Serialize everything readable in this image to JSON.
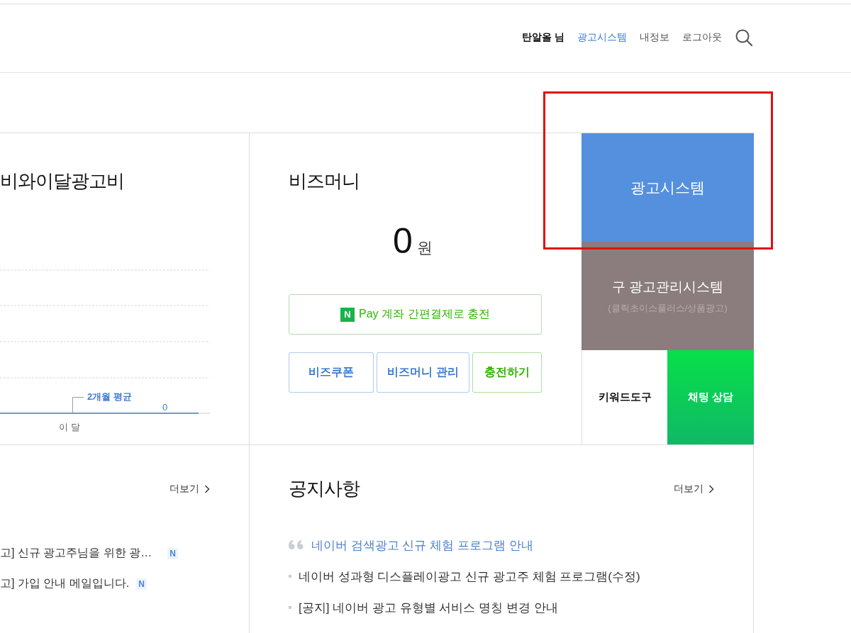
{
  "nav": {
    "items": [
      {
        "label": "탄알올 님",
        "kind": "user",
        "selected": false
      },
      {
        "label": "광고시스템",
        "kind": "link",
        "selected": true
      },
      {
        "label": "내정보",
        "kind": "link",
        "selected": false
      },
      {
        "label": "로그아웃",
        "kind": "link",
        "selected": false
      }
    ]
  },
  "spend_panel": {
    "title": "비와이달광고비",
    "legend_label": "2개월 평균",
    "value": "0",
    "xlabel": "이 달"
  },
  "bizmoney": {
    "title": "비즈머니",
    "amount": "0",
    "unit": "원",
    "npay_button": {
      "badge": "N",
      "label": "Pay 계좌 간편결제로 충전"
    },
    "buttons": [
      {
        "label": "비즈쿠폰",
        "color": "#3d7bd0"
      },
      {
        "label": "비즈머니 관리",
        "color": "#3d7bd0"
      },
      {
        "label": "충전하기",
        "color": "#2db400"
      }
    ]
  },
  "tiles": {
    "ad_system": {
      "label": "광고시스템",
      "highlighted": true
    },
    "old_system": {
      "label": "구 광고관리시스템",
      "sub": "(클릭초이스플러스/상품광고)"
    },
    "keyword_tool": {
      "label": "키워드도구"
    },
    "chat": {
      "label": "채팅 상담"
    }
  },
  "mail_panel": {
    "more": "더보기",
    "items": [
      {
        "text": "고] 신규 광고주님을 위한 광…",
        "new": true,
        "badge": "N"
      },
      {
        "text": "고] 가입 안내 메일입니다.",
        "new": true,
        "badge": "N"
      }
    ]
  },
  "notice_panel": {
    "title": "공지사항",
    "more": "더보기",
    "items": [
      {
        "text": "네이버 검색광고 신규 체험 프로그램 안내",
        "kind": "featured"
      },
      {
        "text": "네이버 성과형 디스플레이광고 신규 광고주 체험 프로그램(수정)",
        "kind": "normal"
      },
      {
        "text": "[공지] 네이버 광고 유형별 서비스 명칭 변경 안내",
        "kind": "normal"
      }
    ]
  }
}
